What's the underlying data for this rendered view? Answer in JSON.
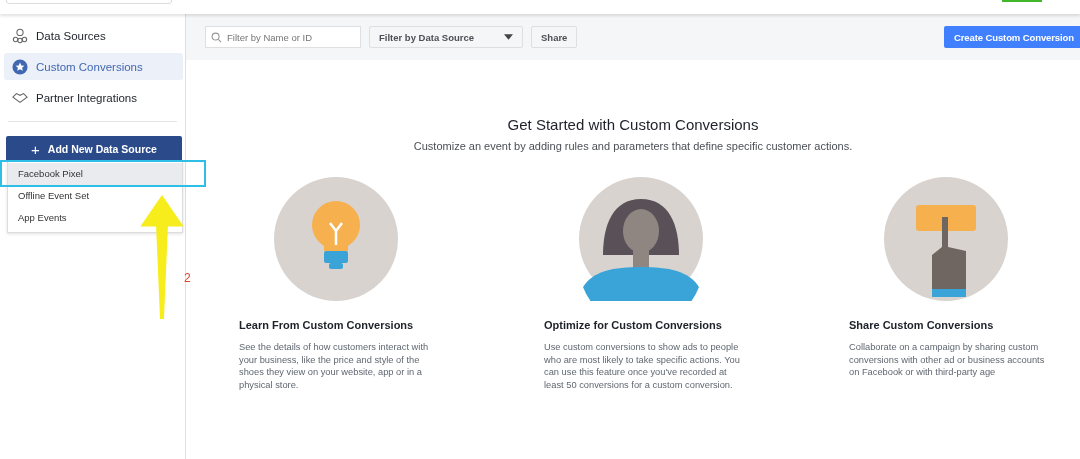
{
  "sidebar": {
    "items": [
      {
        "label": "Data Sources",
        "selected": false
      },
      {
        "label": "Custom Conversions",
        "selected": true
      },
      {
        "label": "Partner Integrations",
        "selected": false
      }
    ],
    "add_button": {
      "label": "Add New Data Source",
      "icon": "+"
    },
    "menu": [
      {
        "label": "Facebook Pixel",
        "selected": true
      },
      {
        "label": "Offline Event Set",
        "selected": false
      },
      {
        "label": "App Events",
        "selected": false
      }
    ]
  },
  "toolbar": {
    "search": {
      "placeholder": "Filter by Name or ID"
    },
    "filter": {
      "label": "Filter by Data Source"
    },
    "share": "Share",
    "create": "Create Custom Conversion"
  },
  "intro": {
    "title": "Get Started with Custom Conversions",
    "subtitle": "Customize an event by adding rules and parameters that define specific customer actions."
  },
  "cards": [
    {
      "kind": "bulb",
      "title": "Learn From Custom Conversions",
      "text": "See the details of how customers interact with your business, like the price and style of the shoes they view on your website, app or in a physical store."
    },
    {
      "kind": "person",
      "title": "Optimize for Custom Conversions",
      "text": "Use custom conversions to show ads to people who are most likely to take specific actions. You can use this feature once you've recorded at least 50 conversions for a custom conversion."
    },
    {
      "kind": "hand",
      "title": "Share Custom Conversions",
      "text": "Collaborate on a campaign by sharing custom conversions with other ad or business accounts on Facebook or with third-party age"
    }
  ],
  "annotation": {
    "label": "2"
  }
}
